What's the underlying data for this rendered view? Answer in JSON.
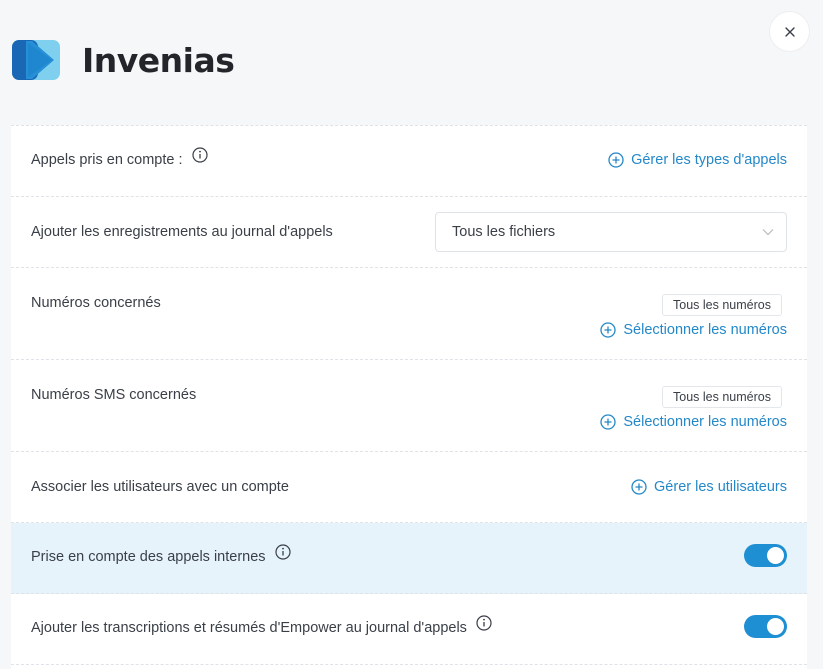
{
  "app": {
    "title": "Invenias"
  },
  "colors": {
    "accent": "#1e8fd2",
    "link": "#2488c8",
    "highlight": "#e6f3fb"
  },
  "icons": {
    "close": "close-icon",
    "info": "info-icon",
    "add": "plus-circle-icon",
    "dropdown": "chevron-down-icon"
  },
  "rows": {
    "calls": {
      "label": "Appels pris en compte :",
      "link": "Gérer les types d'appels"
    },
    "recordings": {
      "label": "Ajouter les enregistrements au journal d'appels",
      "select_value": "Tous les fichiers"
    },
    "numbers": {
      "label": "Numéros concernés",
      "chip": "Tous les numéros",
      "link": "Sélectionner les numéros"
    },
    "sms_numbers": {
      "label": "Numéros SMS concernés",
      "chip": "Tous les numéros",
      "link": "Sélectionner les numéros"
    },
    "users": {
      "label": "Associer les utilisateurs avec un compte",
      "link": "Gérer les utilisateurs"
    },
    "internal_calls": {
      "label": "Prise en compte des appels internes",
      "enabled": true
    },
    "transcriptions": {
      "label": "Ajouter les transcriptions et résumés d'Empower au journal d'appels",
      "enabled": true
    }
  }
}
